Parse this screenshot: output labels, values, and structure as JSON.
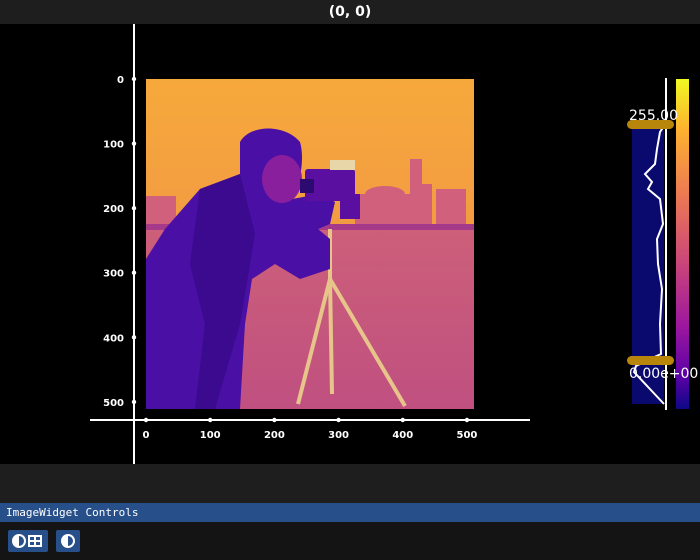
{
  "window": {
    "title": "(0, 0)"
  },
  "controls": {
    "header_label": "ImageWidget Controls",
    "buttons": [
      {
        "icon": "contrast-film-icon"
      },
      {
        "icon": "contrast-icon"
      }
    ]
  },
  "image_plot": {
    "image_subject": "cameraman",
    "colormap": "plasma",
    "x_axis": {
      "ticks": [
        0,
        100,
        200,
        300,
        400,
        500
      ],
      "tick_labels": [
        "0",
        "100",
        "200",
        "300",
        "400",
        "500"
      ],
      "range": [
        0,
        511
      ]
    },
    "y_axis": {
      "ticks": [
        0,
        100,
        200,
        300,
        400,
        500
      ],
      "tick_labels": [
        "0",
        "100",
        "200",
        "300",
        "400",
        "500"
      ],
      "range": [
        0,
        511
      ]
    }
  },
  "histogram": {
    "vmax_label": "255.00",
    "vmin_label": "0.00e+00",
    "vmax": 255,
    "vmin": 0
  },
  "colors": {
    "background": "#000000",
    "chrome": "#1e1e1e",
    "controls_accent": "#27508a",
    "handle": "#b8860b",
    "histogram_bg": "#0a0a6e"
  }
}
